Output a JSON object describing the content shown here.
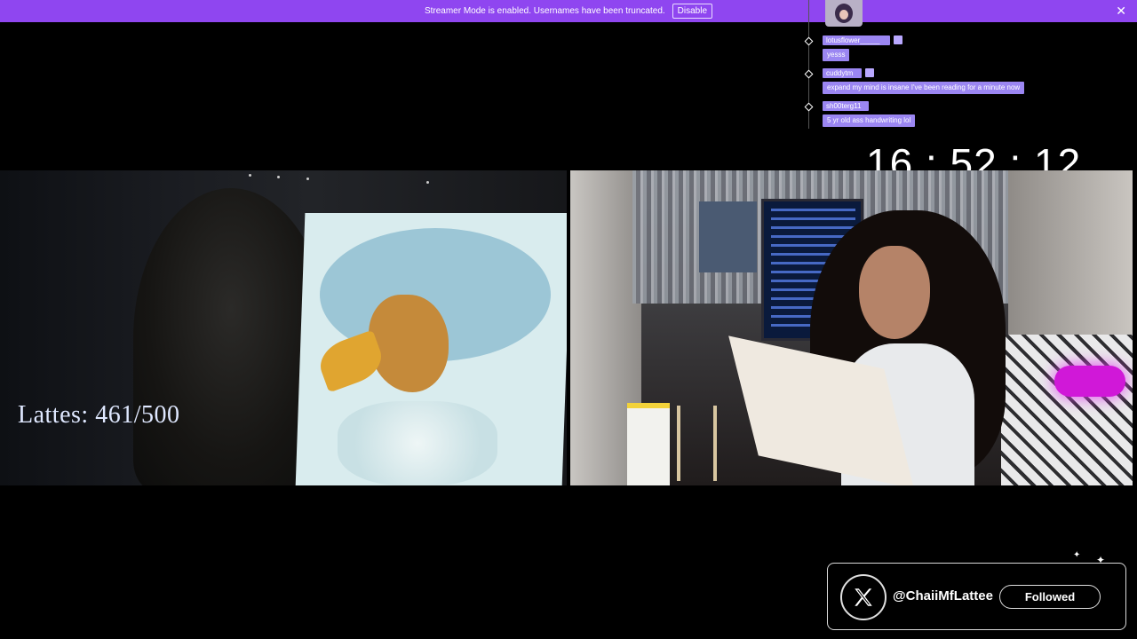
{
  "banner": {
    "message": "Streamer Mode is enabled. Usernames have been truncated.",
    "disable_label": "Disable",
    "close_symbol": "✕",
    "color": "#8f46f0"
  },
  "chat": {
    "messages": [
      {
        "user": "lotusflower_____",
        "text": "yesss"
      },
      {
        "user": "cuddytm",
        "text": "expand my mind is insane I've been reading for a minute now"
      },
      {
        "user": "sh00terg11",
        "text": "5 yr old ass handwriting lol"
      }
    ],
    "bubble_color": "#9b86f2"
  },
  "clock": {
    "time": "16 : 52 : 12"
  },
  "lattes": {
    "label": "Lattes: 461/500"
  },
  "twitter": {
    "handle": "@ChaiiMfLattee",
    "follow_label": "Followed",
    "logo_icon": "x-logo-icon",
    "bird_icon": "twitter-bird-icon"
  }
}
